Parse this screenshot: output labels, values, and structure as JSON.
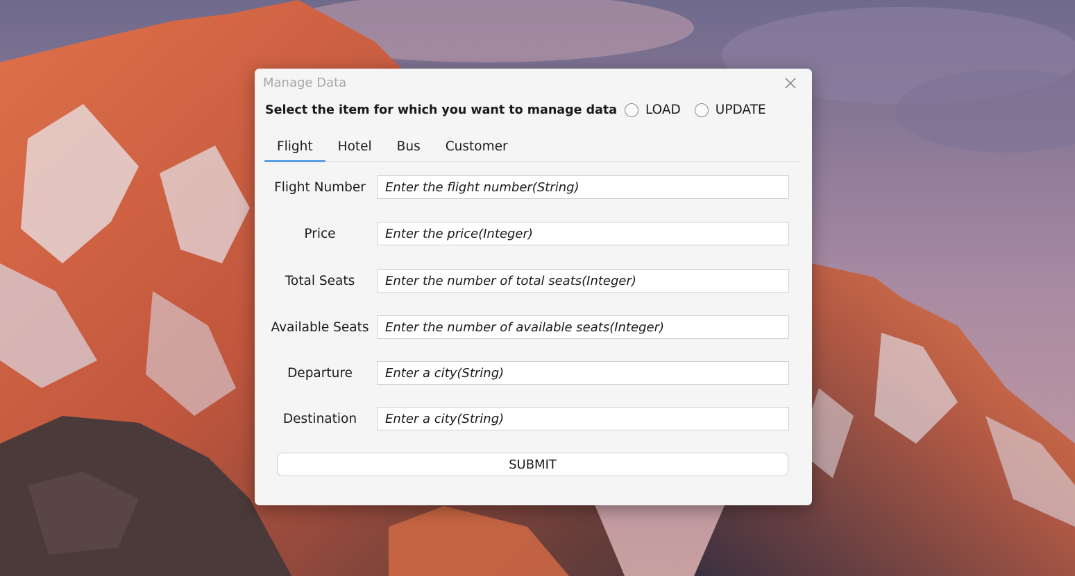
{
  "window": {
    "title": "Manage Data"
  },
  "prompt": "Select the item for which you want to manage data",
  "radios": [
    {
      "label": "LOAD",
      "checked": false
    },
    {
      "label": "UPDATE",
      "checked": false
    }
  ],
  "tabs": [
    {
      "label": "Flight",
      "active": true
    },
    {
      "label": "Hotel",
      "active": false
    },
    {
      "label": "Bus",
      "active": false
    },
    {
      "label": "Customer",
      "active": false
    }
  ],
  "fields": [
    {
      "label": "Flight Number",
      "placeholder": "Enter the flight number(String)"
    },
    {
      "label": "Price",
      "placeholder": "Enter the price(Integer)"
    },
    {
      "label": "Total Seats",
      "placeholder": "Enter the number of total seats(Integer)"
    },
    {
      "label": "Available Seats",
      "placeholder": "Enter the number of available seats(Integer)"
    },
    {
      "label": "Departure",
      "placeholder": "Enter a city(String)"
    },
    {
      "label": "Destination",
      "placeholder": "Enter a city(String)"
    }
  ],
  "submit_label": "SUBMIT",
  "colors": {
    "accent": "#5aa0e0",
    "dialog_bg": "#f5f5f5",
    "title_text": "#a7a7a7"
  },
  "icons": {
    "close": "close-icon"
  }
}
